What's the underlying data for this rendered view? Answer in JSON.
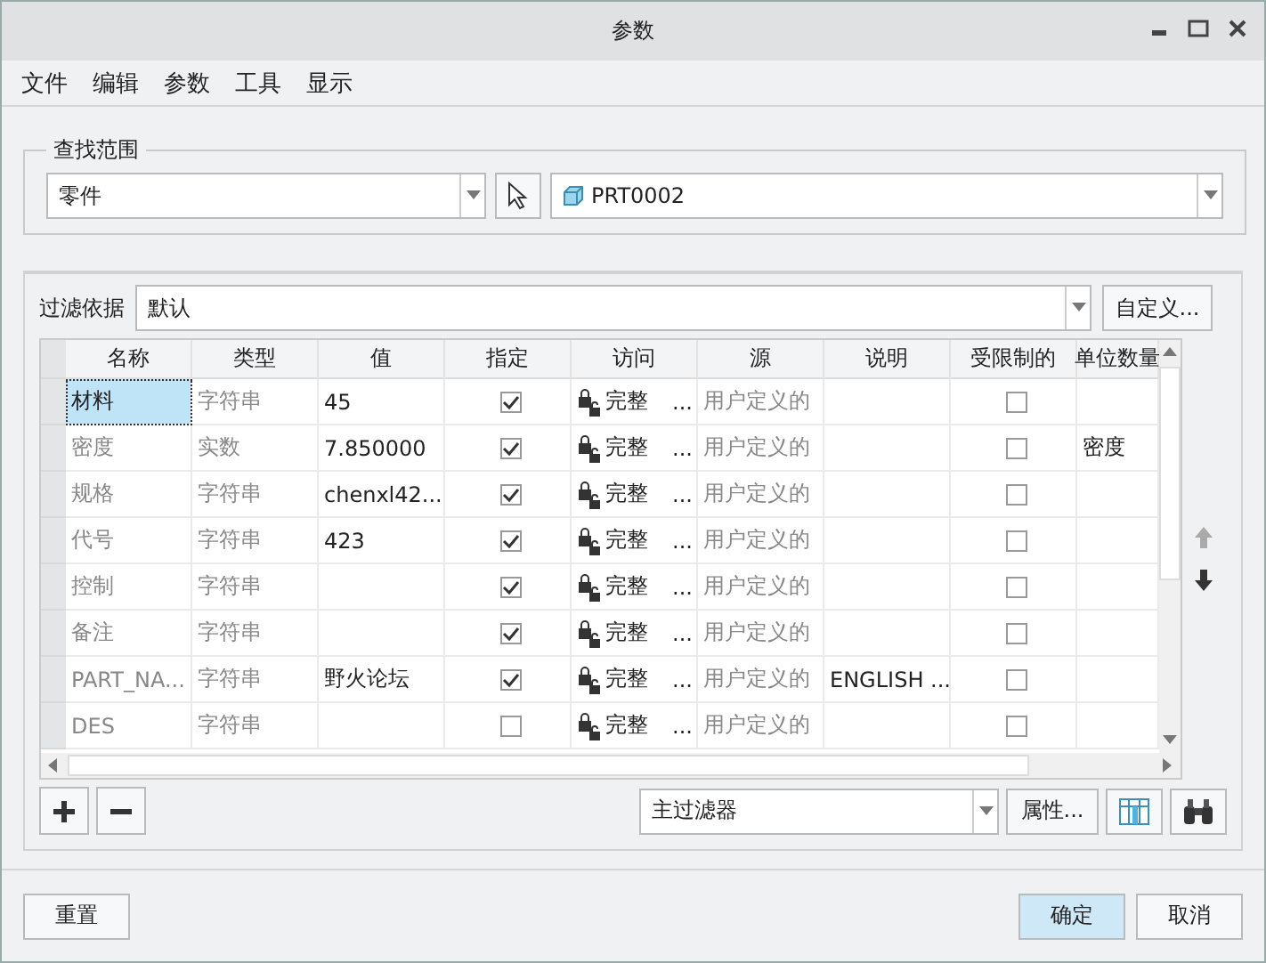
{
  "window": {
    "title": "参数"
  },
  "menu": [
    "文件",
    "编辑",
    "参数",
    "工具",
    "显示"
  ],
  "scope": {
    "label": "查找范围",
    "type": "零件",
    "object": "PRT0002"
  },
  "filter": {
    "label": "过滤依据",
    "value": "默认",
    "button": "自定义..."
  },
  "table": {
    "columns": [
      "名称",
      "类型",
      "值",
      "指定",
      "访问",
      "源",
      "说明",
      "受限制的",
      "单位数量"
    ],
    "rows": [
      {
        "name": "材料",
        "type": "字符串",
        "value": "45",
        "designated": true,
        "access": "完整",
        "access_more": "...",
        "source": "用户定义的",
        "description": "",
        "restricted": false,
        "unit": "",
        "selected": true
      },
      {
        "name": "密度",
        "type": "实数",
        "value": "7.850000",
        "designated": true,
        "access": "完整",
        "access_more": "...",
        "source": "用户定义的",
        "description": "",
        "restricted": false,
        "unit": "密度",
        "selected": false
      },
      {
        "name": "规格",
        "type": "字符串",
        "value": "chenxl42...",
        "designated": true,
        "access": "完整",
        "access_more": "...",
        "source": "用户定义的",
        "description": "",
        "restricted": false,
        "unit": "",
        "selected": false
      },
      {
        "name": "代号",
        "type": "字符串",
        "value": "423",
        "designated": true,
        "access": "完整",
        "access_more": "...",
        "source": "用户定义的",
        "description": "",
        "restricted": false,
        "unit": "",
        "selected": false
      },
      {
        "name": "控制",
        "type": "字符串",
        "value": "",
        "designated": true,
        "access": "完整",
        "access_more": "...",
        "source": "用户定义的",
        "description": "",
        "restricted": false,
        "unit": "",
        "selected": false
      },
      {
        "name": "备注",
        "type": "字符串",
        "value": "",
        "designated": true,
        "access": "完整",
        "access_more": "...",
        "source": "用户定义的",
        "description": "",
        "restricted": false,
        "unit": "",
        "selected": false
      },
      {
        "name": "PART_NA...",
        "type": "字符串",
        "value": "野火论坛",
        "designated": true,
        "access": "完整",
        "access_more": "...",
        "source": "用户定义的",
        "description": "ENGLISH ...",
        "restricted": false,
        "unit": "",
        "selected": false
      },
      {
        "name": "DES",
        "type": "字符串",
        "value": "",
        "designated": false,
        "access": "完整",
        "access_more": "...",
        "source": "用户定义的",
        "description": "",
        "restricted": false,
        "unit": "",
        "selected": false
      }
    ]
  },
  "toolbar": {
    "filter": "主过滤器",
    "properties": "属性..."
  },
  "footer": {
    "reset": "重置",
    "ok": "确定",
    "cancel": "取消"
  }
}
